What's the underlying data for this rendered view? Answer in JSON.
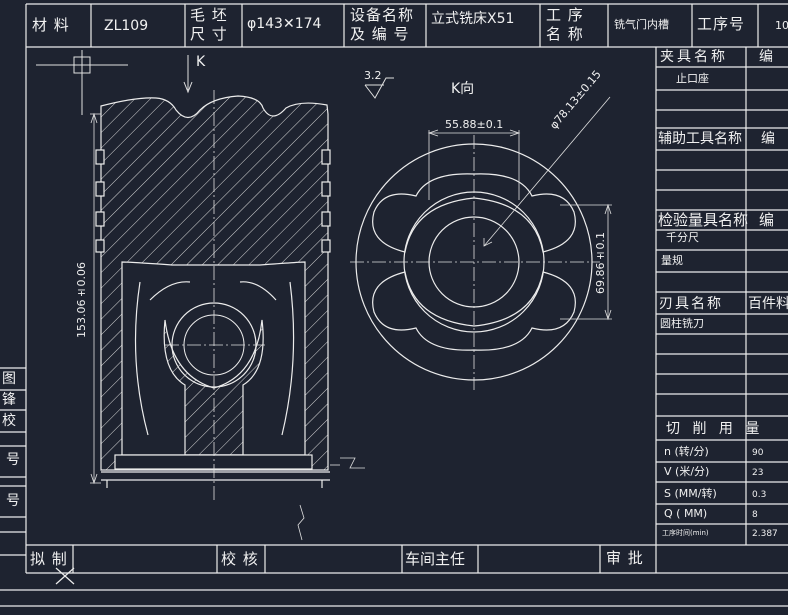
{
  "header": {
    "material_label": "材 料",
    "material_value": "ZL109",
    "blank_size_label_1": "毛 坯",
    "blank_size_label_2": "尺 寸",
    "blank_size_value": "φ143✕174",
    "equipment_label_1": "设备名称",
    "equipment_label_2": "及 编 号",
    "equipment_value": "立式铣床X51",
    "process_name_label_1": "工  序",
    "process_name_label_2": "名  称",
    "process_name_value": "铣气门内槽",
    "process_no_label": "工序号",
    "process_no_value": "10"
  },
  "drawing": {
    "section_k_label": "K",
    "view_k_title": "K向",
    "surface_finish": "3.2",
    "dim_height": "153.06±0.06",
    "dim_width_top": "55.88±0.1",
    "dim_diameter": "φ78.13±0.15",
    "dim_vertical": "69.86±0.1"
  },
  "right_table": {
    "fixture_header": "夹具名称",
    "fixture_code_header": "编",
    "fixture_item": "止口座",
    "aux_header": "辅助工具名称",
    "aux_code_header": "编",
    "inspection_header": "检验量具名称",
    "inspection_code_header": "编",
    "inspection_items": [
      "千分尺",
      "量规"
    ],
    "tool_header": "刃具名称",
    "tool_code_header": "百件料",
    "tool_item": "圆柱铣刀",
    "cutting_header": "切  削  用  量",
    "cutting_rows": [
      {
        "param": "n (转/分)",
        "value": "90"
      },
      {
        "param": "V (米/分)",
        "value": "23"
      },
      {
        "param": "S (MM/转)",
        "value": "0.3"
      },
      {
        "param": "Q ( MM)",
        "value": "8"
      },
      {
        "param": "工序时间(min)",
        "value": "2.387"
      }
    ]
  },
  "left_strip": [
    "图",
    "锋",
    "校",
    "号",
    "号"
  ],
  "footer": {
    "prepared": "拟 制",
    "checked": "校 核",
    "workshop": "车间主任",
    "approved": "审  批"
  }
}
